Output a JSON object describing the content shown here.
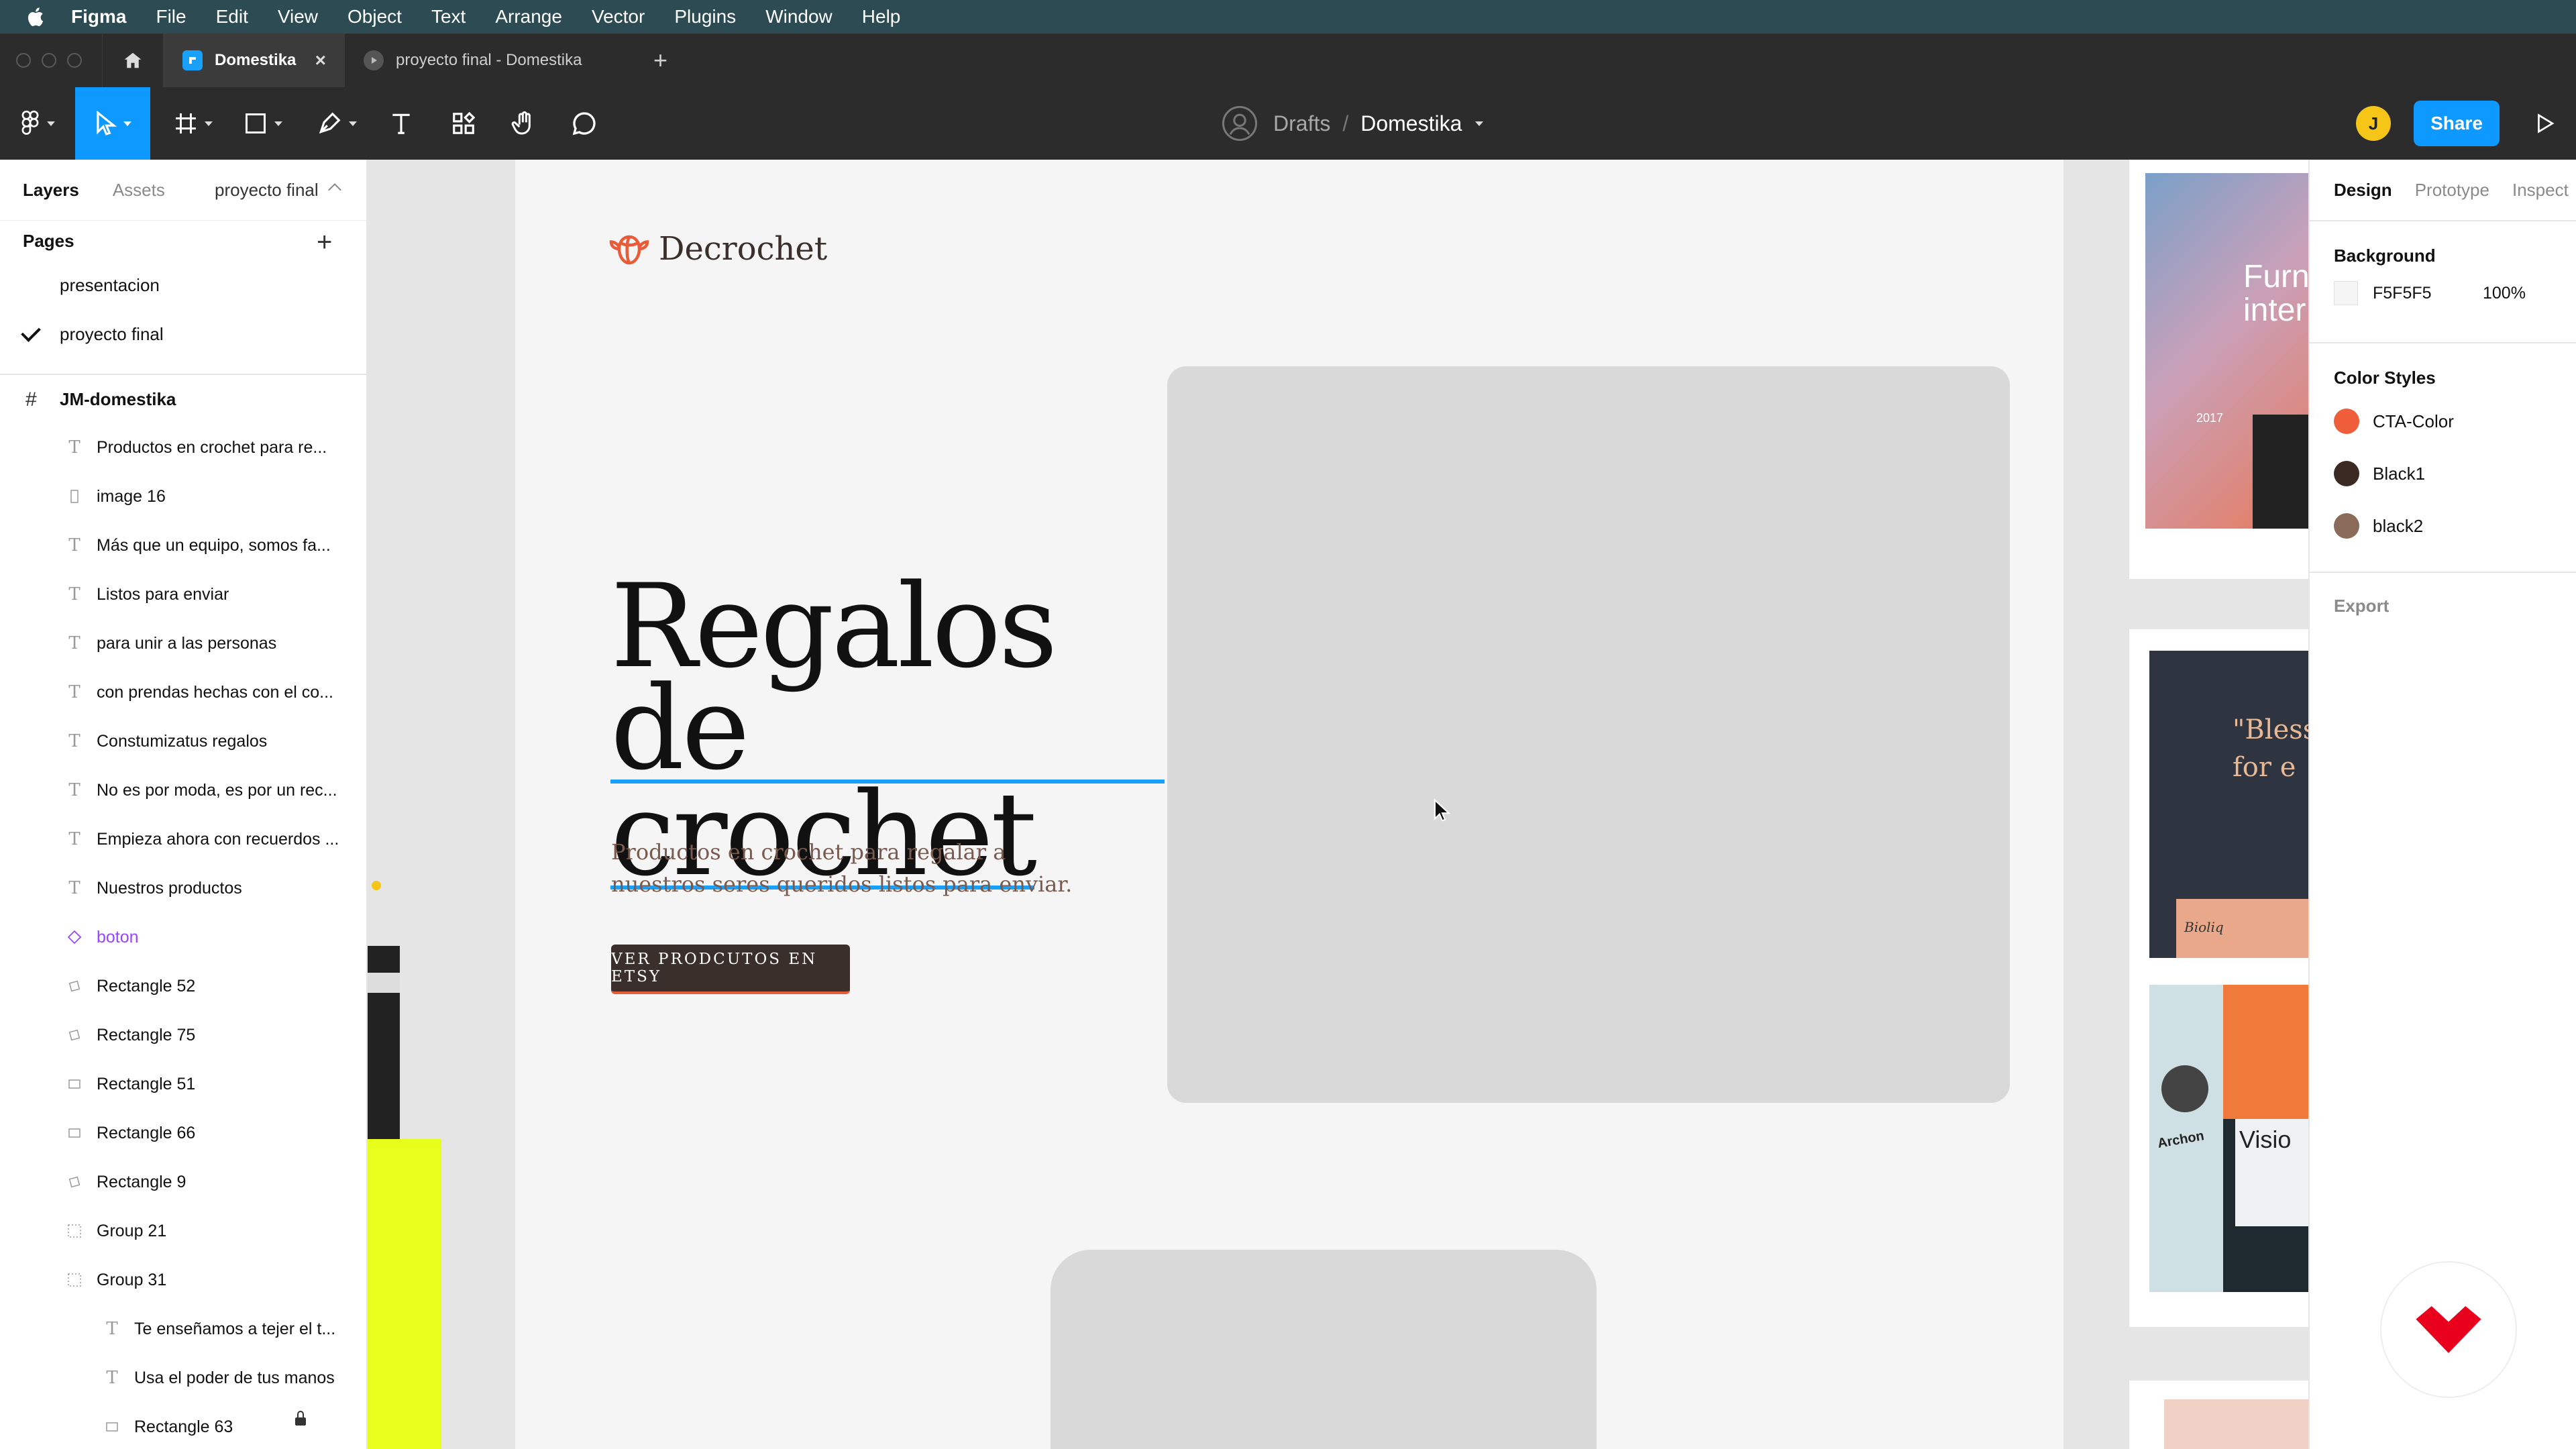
{
  "menubar": {
    "app": "Figma",
    "items": [
      "File",
      "Edit",
      "View",
      "Object",
      "Text",
      "Arrange",
      "Vector",
      "Plugins",
      "Window",
      "Help"
    ]
  },
  "tabs": {
    "active": "Domestika",
    "inactive": "proyecto final - Domestika"
  },
  "toolbar": {
    "drafts": "Drafts",
    "file_name": "Domestika",
    "avatar_initial": "J",
    "share_label": "Share"
  },
  "left_panel": {
    "tab_layers": "Layers",
    "tab_assets": "Assets",
    "current_page": "proyecto final",
    "pages_title": "Pages",
    "pages": [
      "presentacion",
      "proyecto final"
    ],
    "frame": "JM-domestika",
    "layers": [
      {
        "name": "Productos en crochet para re...",
        "icon": "text-icon"
      },
      {
        "name": "image 16",
        "icon": "image-icon"
      },
      {
        "name": "Más que un equipo, somos fa...",
        "icon": "text-icon"
      },
      {
        "name": "Listos para enviar",
        "icon": "text-icon"
      },
      {
        "name": "para unir a las personas",
        "icon": "text-icon"
      },
      {
        "name": "con prendas hechas con el co...",
        "icon": "text-icon"
      },
      {
        "name": "Constumizatus regalos",
        "icon": "text-icon"
      },
      {
        "name": "No es por moda, es por un rec...",
        "icon": "text-icon"
      },
      {
        "name": "Empieza ahora con recuerdos ...",
        "icon": "text-icon"
      },
      {
        "name": "Nuestros productos",
        "icon": "text-icon"
      },
      {
        "name": "boton",
        "icon": "component-icon"
      },
      {
        "name": "Rectangle 52",
        "icon": "rect-rotated-icon"
      },
      {
        "name": "Rectangle 75",
        "icon": "rect-rotated-icon"
      },
      {
        "name": "Rectangle 51",
        "icon": "rect-icon"
      },
      {
        "name": "Rectangle 66",
        "icon": "rect-icon"
      },
      {
        "name": "Rectangle 9",
        "icon": "rect-rotated-icon"
      },
      {
        "name": "Group 21",
        "icon": "group-icon"
      },
      {
        "name": "Group 31",
        "icon": "group-icon"
      },
      {
        "name": "Te enseñamos a tejer el t...",
        "icon": "text-icon"
      },
      {
        "name": "Usa el poder de tus manos",
        "icon": "text-icon"
      },
      {
        "name": "Rectangle 63",
        "icon": "rect-icon"
      }
    ]
  },
  "canvas": {
    "logo_text": "Decrochet",
    "hero_line1": "Regalos de",
    "hero_line2": "crochet",
    "hero_sub": "Productos en crochet para regalar a nuestros seres queridos listos para enviar.",
    "cta_label": "VER PRODCUTOS EN ETSY",
    "thumb1_big": "Furn inter",
    "thumb1_year": "2017",
    "thumb2_quote": "\"Bless for e",
    "thumb2_small": "Bioliq",
    "thumb3_brand": "Archon",
    "thumb3_word": "Visio"
  },
  "right_panel": {
    "tabs": [
      "Design",
      "Prototype",
      "Inspect"
    ],
    "background_title": "Background",
    "background_hex": "F5F5F5",
    "background_opacity": "100%",
    "color_styles_title": "Color Styles",
    "color_styles": [
      {
        "name": "CTA-Color",
        "color": "#ef5d3b"
      },
      {
        "name": "Black1",
        "color": "#3b2a24"
      },
      {
        "name": "black2",
        "color": "#8a6a58"
      }
    ],
    "export_title": "Export"
  },
  "colors": {
    "figma_blue": "#0d99ff",
    "cta_brown": "#3a2f2a",
    "accent_orange": "#e85c3a"
  }
}
